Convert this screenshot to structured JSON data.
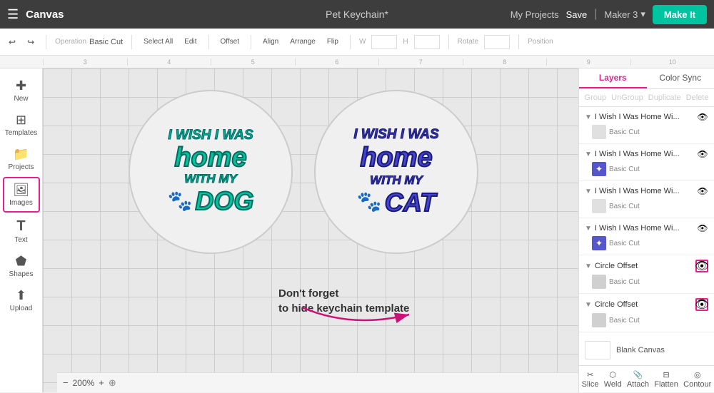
{
  "nav": {
    "hamburger": "☰",
    "title": "Canvas",
    "project_title": "Pet Keychain*",
    "my_projects": "My Projects",
    "save": "Save",
    "maker_label": "Maker 3",
    "make_it": "Make It"
  },
  "toolbar": {
    "undo_label": "Undo",
    "redo_label": "Redo",
    "operation_label": "Operation",
    "operation_value": "Basic Cut",
    "select_all": "Select All",
    "edit": "Edit",
    "offset": "Offset",
    "align": "Align",
    "arrange": "Arrange",
    "flip": "Flip",
    "size": "Size",
    "rotate": "Rotate",
    "position": "Position"
  },
  "ruler": {
    "marks": [
      "3",
      "4",
      "5",
      "6",
      "7",
      "8",
      "9",
      "10"
    ]
  },
  "sidebar": {
    "new": "New",
    "templates": "Templates",
    "projects": "Projects",
    "images": "Images",
    "text": "Text",
    "shapes": "Shapes",
    "upload": "Upload"
  },
  "canvas": {
    "zoom": "200%",
    "dog_lines": [
      "I WISH I WAS",
      "home",
      "WITH MY",
      "🐾DOG"
    ],
    "cat_lines": [
      "I WISH I WAS",
      "home",
      "WITH MY",
      "🐾CAT"
    ],
    "annotation": "Don't forget\nto hide keychain template"
  },
  "layers_panel": {
    "tab_layers": "Layers",
    "tab_color_sync": "Color Sync",
    "group": "Group",
    "ungroup": "UnGroup",
    "duplicate": "Duplicate",
    "delete": "Delete",
    "layers": [
      {
        "name": "I Wish I Was Home Wi...",
        "sub": "Basic Cut",
        "thumb_color": "#e0e0e0",
        "has_eye": false
      },
      {
        "name": "I Wish I Was Home Wi...",
        "sub": "Basic Cut",
        "thumb_color": "#5555cc",
        "has_eye": false
      },
      {
        "name": "I Wish I Was Home Wi...",
        "sub": "Basic Cut",
        "thumb_color": "#e0e0e0",
        "has_eye": false
      },
      {
        "name": "I Wish I Was Home Wi...",
        "sub": "Basic Cut",
        "thumb_color": "#5555cc",
        "has_eye": false
      },
      {
        "name": "Circle Offset",
        "sub": "Basic Cut",
        "thumb_color": "#e0e0e0",
        "has_eye": true,
        "eye_highlighted": true
      },
      {
        "name": "Circle Offset",
        "sub": "Basic Cut",
        "thumb_color": "#e0e0e0",
        "has_eye": true,
        "eye_highlighted": true
      }
    ],
    "blank_canvas": "Blank Canvas"
  },
  "bottom_actions": {
    "slice": "Slice",
    "weld": "Weld",
    "attach": "Attach",
    "flatten": "Flatten",
    "contour": "Contour"
  }
}
